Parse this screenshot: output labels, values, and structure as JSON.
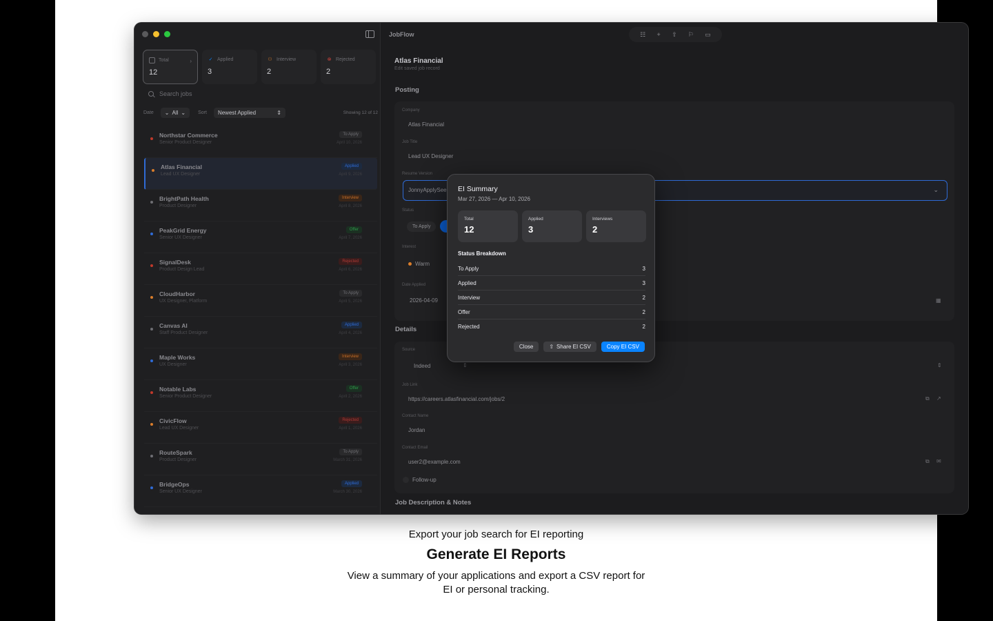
{
  "app": {
    "title": "JobFlow"
  },
  "stats": [
    {
      "label": "Total",
      "value": "12",
      "icon": "tray-icon",
      "color": "#6e6e73"
    },
    {
      "label": "Applied",
      "value": "3",
      "icon": "check-icon",
      "color": "#0a84ff"
    },
    {
      "label": "Interview",
      "value": "2",
      "icon": "people-icon",
      "color": "#d97d2b"
    },
    {
      "label": "Rejected",
      "value": "2",
      "icon": "x-circle-icon",
      "color": "#d6453d"
    }
  ],
  "search": {
    "placeholder": "Search jobs"
  },
  "filters": {
    "date_label": "Date",
    "date_value": "All",
    "sort_label": "Sort",
    "sort_value": "Newest Applied",
    "showing": "Showing 12 of 12"
  },
  "jobs": [
    {
      "company": "Northstar Commerce",
      "role": "Senior Product Designer",
      "status": "To Apply",
      "date": "April 10, 2026",
      "dot": "#c0392b",
      "badge_bg": "#2a2a2c",
      "badge_fg": "#6e6e73"
    },
    {
      "company": "Atlas Financial",
      "role": "Lead UX Designer",
      "status": "Applied",
      "date": "April 9, 2026",
      "dot": "#d97d2b",
      "badge_bg": "#1c2a40",
      "badge_fg": "#2f6bd6"
    },
    {
      "company": "BrightPath Health",
      "role": "Product Designer",
      "status": "Interview",
      "date": "April 8, 2026",
      "dot": "#6e6e73",
      "badge_bg": "#3a2618",
      "badge_fg": "#c56d27"
    },
    {
      "company": "PeakGrid Energy",
      "role": "Senior UX Designer",
      "status": "Offer",
      "date": "April 7, 2026",
      "dot": "#2f6bd6",
      "badge_bg": "#1b3022",
      "badge_fg": "#2e9c4a"
    },
    {
      "company": "SignalDesk",
      "role": "Product Design Lead",
      "status": "Rejected",
      "date": "April 6, 2026",
      "dot": "#c0392b",
      "badge_bg": "#3a1c1c",
      "badge_fg": "#b03a35"
    },
    {
      "company": "CloudHarbor",
      "role": "UX Designer, Platform",
      "status": "To Apply",
      "date": "April 5, 2026",
      "dot": "#d97d2b",
      "badge_bg": "#2a2a2c",
      "badge_fg": "#6e6e73"
    },
    {
      "company": "Canvas AI",
      "role": "Staff Product Designer",
      "status": "Applied",
      "date": "April 4, 2026",
      "dot": "#6e6e73",
      "badge_bg": "#1c2a40",
      "badge_fg": "#2f6bd6"
    },
    {
      "company": "Maple Works",
      "role": "UX Designer",
      "status": "Interview",
      "date": "April 3, 2026",
      "dot": "#2f6bd6",
      "badge_bg": "#3a2618",
      "badge_fg": "#c56d27"
    },
    {
      "company": "Notable Labs",
      "role": "Senior Product Designer",
      "status": "Offer",
      "date": "April 2, 2026",
      "dot": "#c0392b",
      "badge_bg": "#1b3022",
      "badge_fg": "#2e9c4a"
    },
    {
      "company": "CivicFlow",
      "role": "Lead UX Designer",
      "status": "Rejected",
      "date": "April 1, 2026",
      "dot": "#d97d2b",
      "badge_bg": "#3a1c1c",
      "badge_fg": "#b03a35"
    },
    {
      "company": "RouteSpark",
      "role": "Product Designer",
      "status": "To Apply",
      "date": "March 31, 2026",
      "dot": "#6e6e73",
      "badge_bg": "#2a2a2c",
      "badge_fg": "#6e6e73"
    },
    {
      "company": "BridgeOps",
      "role": "Senior UX Designer",
      "status": "Applied",
      "date": "March 30, 2026",
      "dot": "#2f6bd6",
      "badge_bg": "#1c2a40",
      "badge_fg": "#2f6bd6"
    }
  ],
  "record": {
    "title": "Atlas Financial",
    "subtitle": "Edit saved job record",
    "posting_header": "Posting",
    "company_label": "Company",
    "company_value": "Atlas Financial",
    "job_title_label": "Job Title",
    "job_title_value": "Lead UX Designer",
    "resume_label": "Resume Version",
    "resume_value": "JonnyApplySee",
    "status_label": "Status",
    "status_value": "To Apply",
    "interest_label": "Interest",
    "interest_value": "Warm",
    "date_applied_label": "Date Applied",
    "date_applied_value": "2026-04-09",
    "details_header": "Details",
    "source_label": "Source",
    "source_value": "Indeed",
    "job_link_label": "Job Link",
    "job_link_value": "https://careers.atlasfinancial.com/jobs/2",
    "contact_name_label": "Contact Name",
    "contact_name_value": "Jordan",
    "contact_email_label": "Contact Email",
    "contact_email_value": "user2@example.com",
    "follow_up_label": "Follow-up",
    "notes_header": "Job Description & Notes"
  },
  "dialog": {
    "title": "EI Summary",
    "range": "Mar 27, 2026 — Apr 10, 2026",
    "stats": [
      {
        "label": "Total",
        "value": "12"
      },
      {
        "label": "Applied",
        "value": "3"
      },
      {
        "label": "Interviews",
        "value": "2"
      }
    ],
    "breakdown_title": "Status Breakdown",
    "breakdown": [
      {
        "status": "To Apply",
        "count": "3"
      },
      {
        "status": "Applied",
        "count": "3"
      },
      {
        "status": "Interview",
        "count": "2"
      },
      {
        "status": "Offer",
        "count": "2"
      },
      {
        "status": "Rejected",
        "count": "2"
      }
    ],
    "close_label": "Close",
    "share_label": "Share EI CSV",
    "copy_label": "Copy EI CSV"
  },
  "caption": {
    "eyebrow": "Export your job search for EI reporting",
    "headline": "Generate EI Reports",
    "body_line1": "View a summary of your applications and export a CSV report for",
    "body_line2": "EI or personal tracking."
  }
}
